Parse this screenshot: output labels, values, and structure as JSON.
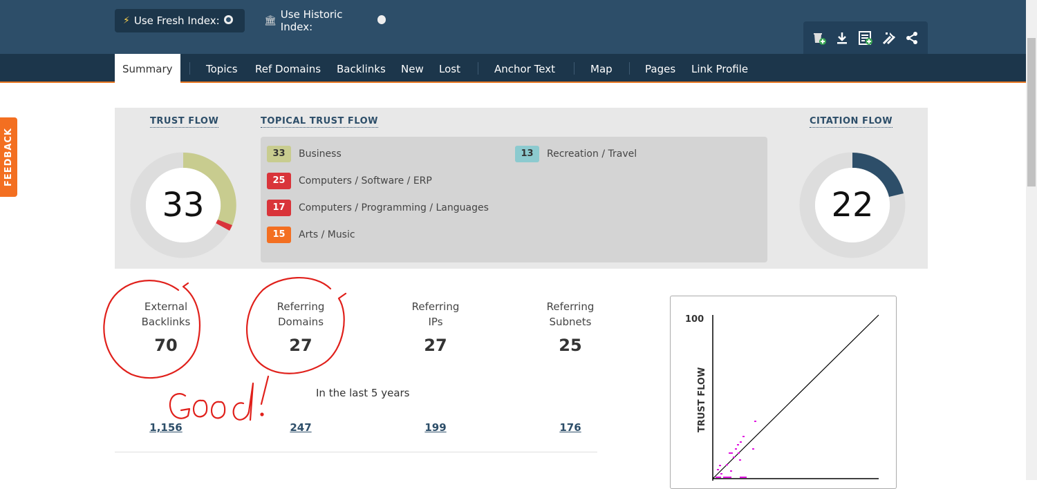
{
  "index_toggle": {
    "fresh_label": "Use Fresh Index:",
    "historic_label": "Use Historic Index:"
  },
  "toolbar_icons": [
    "add-to-bucket-icon",
    "download-icon",
    "report-icon",
    "tools-icon",
    "share-icon"
  ],
  "nav": {
    "tabs": [
      "Summary",
      "Topics",
      "Ref Domains",
      "Backlinks",
      "New",
      "Lost",
      "Anchor Text",
      "Map",
      "Pages",
      "Link Profile"
    ],
    "active": "Summary"
  },
  "feedback_label": "FEEDBACK",
  "trust_flow": {
    "title": "TRUST FLOW",
    "value": "33"
  },
  "citation_flow": {
    "title": "CITATION FLOW",
    "value": "22"
  },
  "topical": {
    "title": "TOPICAL TRUST FLOW",
    "items": [
      {
        "score": "33",
        "label": "Business",
        "color": "#c8cc8f"
      },
      {
        "score": "25",
        "label": "Computers / Software / ERP",
        "color": "#d9343a"
      },
      {
        "score": "17",
        "label": "Computers / Programming / Languages",
        "color": "#d9343a"
      },
      {
        "score": "15",
        "label": "Arts / Music",
        "color": "#f36f21"
      },
      {
        "score": "13",
        "label": "Recreation / Travel",
        "color": "#8ccacf"
      }
    ]
  },
  "stats": [
    {
      "label1": "External",
      "label2": "Backlinks",
      "value": "70",
      "historic": "1,156"
    },
    {
      "label1": "Referring",
      "label2": "Domains",
      "value": "27",
      "historic": "247"
    },
    {
      "label1": "Referring",
      "label2": "IPs",
      "value": "27",
      "historic": "199"
    },
    {
      "label1": "Referring",
      "label2": "Subnets",
      "value": "25",
      "historic": "176"
    }
  ],
  "historic_caption": "In the last 5 years",
  "scatter": {
    "y_axis_label": "TRUST FLOW",
    "y_max_label": "100"
  },
  "annotation": {
    "text": "Good!",
    "color": "#e0201b"
  },
  "colors": {
    "header": "#2d4e69",
    "nav": "#1c364b",
    "accent": "#e87722",
    "tf_gauge": "#c8cc8f",
    "cf_gauge": "#2d4e69"
  }
}
